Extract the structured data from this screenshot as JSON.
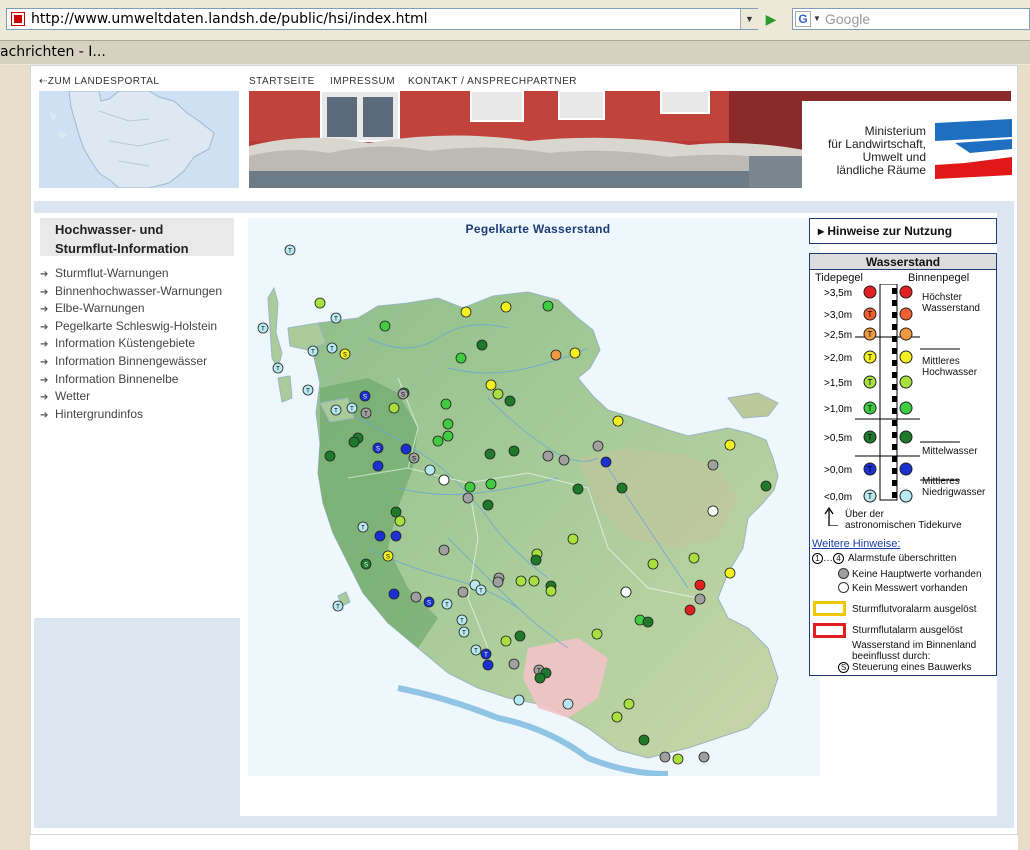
{
  "browser": {
    "url": "http://www.umweltdaten.landsh.de/public/hsi/index.html",
    "search_placeholder": "Google",
    "tab_title": "achrichten - I..."
  },
  "header": {
    "back_link": "ZUM LANDESPORTAL",
    "nav": [
      "STARTSEITE",
      "IMPRESSUM",
      "KONTAKT / ANSPRECHPARTNER"
    ],
    "ministry": [
      "Ministerium",
      "für Landwirtschaft,",
      "Umwelt und",
      "ländliche Räume"
    ]
  },
  "sidebar": {
    "title_line1": "Hochwasser- und",
    "title_line2": "Sturmflut-Information",
    "items": [
      "Sturmflut-Warnungen",
      "Binnenhochwasser-Warnungen",
      "Elbe-Warnungen",
      "Pegelkarte Schleswig-Holstein",
      "Information Küstengebiete",
      "Information Binnengewässer",
      "Information Binnenelbe",
      "Wetter",
      "Hintergrundinfos"
    ]
  },
  "map": {
    "title": "Pegelkarte Wasserstand"
  },
  "legend": {
    "hinweise_button": "Hinweise zur Nutzung",
    "title": "Wasserstand",
    "col_tide": "Tidepegel",
    "col_binnen": "Binnenpegel",
    "levels": [
      {
        "label": ">3,5m",
        "color": "#e02020",
        "tide_letter": "",
        "annotation": "Höchster Wasserstand"
      },
      {
        "label": ">3,0m",
        "color": "#f06030",
        "tide_letter": "T",
        "annotation": ""
      },
      {
        "label": ">2,5m",
        "color": "#f09a40",
        "tide_letter": "T",
        "annotation": ""
      },
      {
        "label": ">2,0m",
        "color": "#f5f020",
        "tide_letter": "T",
        "annotation": "Mittleres Hochwasser"
      },
      {
        "label": ">1,5m",
        "color": "#a8e040",
        "tide_letter": "T",
        "annotation": ""
      },
      {
        "label": ">1,0m",
        "color": "#40cc40",
        "tide_letter": "T",
        "annotation": ""
      },
      {
        "label": ">0,5m",
        "color": "#1e7a2a",
        "tide_letter": "T",
        "annotation": "Mittelwasser"
      },
      {
        "label": ">0,0m",
        "color": "#1a30d0",
        "tide_letter": "T",
        "annotation": "Mittleres Niedrigwasser"
      },
      {
        "label": "<0,0m",
        "color": "#b8e8f0",
        "tide_letter": "T",
        "annotation": ""
      }
    ],
    "annot_hoechster_1": "Höchster",
    "annot_hoechster_2": "Wasserstand",
    "annot_mhw_1": "Mittleres",
    "annot_mhw_2": "Hochwasser",
    "annot_mw": "Mittelwasser",
    "annot_mnw_1": "Mittleres",
    "annot_mnw_2": "Niedrigwasser",
    "tide_note_1": "Über der",
    "tide_note_2": "astronomischen Tidekurve",
    "further_heading": "Weitere Hinweise:",
    "alarm_prefix": "…",
    "alarm_text": "Alarmstufe überschritten",
    "no_main_values": "Keine Hauptwerte vorhanden",
    "no_measurement": "Kein Messwert vorhanden",
    "storm_pre_alarm": "Sturmflutvoralarm ausgelöst",
    "storm_alarm": "Sturmflutalarm ausgelöst",
    "influence_1": "Wasserstand im Binnenland",
    "influence_2": "beeinflusst durch:",
    "control": "Steuerung eines Bauwerks",
    "colors": {
      "pre_alarm_border": "#f0c800",
      "alarm_border": "#e02020",
      "no_main_values": "#a0a0a0",
      "no_measurement": "#ffffff"
    }
  }
}
